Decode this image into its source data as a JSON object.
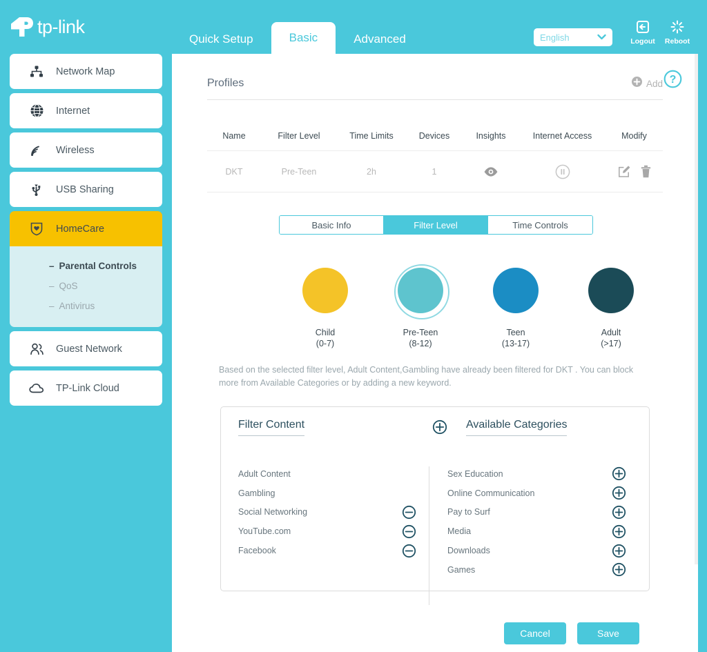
{
  "brand": {
    "name": "tp-link",
    "logo_icon": "tplink-logo-icon"
  },
  "topbar": {
    "tabs": [
      {
        "label": "Quick Setup",
        "active": false
      },
      {
        "label": "Basic",
        "active": true
      },
      {
        "label": "Advanced",
        "active": false
      }
    ],
    "language": {
      "value": "English",
      "chevron_icon": "chevron-down-icon"
    },
    "logout": {
      "label": "Logout",
      "icon": "logout-icon"
    },
    "reboot": {
      "label": "Reboot",
      "icon": "reboot-icon"
    }
  },
  "sidebar": {
    "items": [
      {
        "label": "Network Map",
        "icon": "network-map-icon",
        "active": false
      },
      {
        "label": "Internet",
        "icon": "globe-icon",
        "active": false
      },
      {
        "label": "Wireless",
        "icon": "wireless-signal-icon",
        "active": false
      },
      {
        "label": "USB Sharing",
        "icon": "usb-icon",
        "active": false
      },
      {
        "label": "HomeCare",
        "icon": "shield-heart-icon",
        "active": true
      },
      {
        "label": "Guest Network",
        "icon": "guest-users-icon",
        "active": false
      },
      {
        "label": "TP-Link Cloud",
        "icon": "cloud-icon",
        "active": false
      }
    ],
    "subitems": [
      {
        "label": "Parental Controls",
        "active": true
      },
      {
        "label": "QoS",
        "active": false
      },
      {
        "label": "Antivirus",
        "active": false
      }
    ],
    "active_color": "#f7c100",
    "subnav_bg": "#d8eff2"
  },
  "main": {
    "help_icon": "help-question-icon",
    "profiles": {
      "title": "Profiles",
      "add_label": "Add",
      "add_icon": "plus-circle-icon",
      "columns": [
        "Name",
        "Filter Level",
        "Time Limits",
        "Devices",
        "Insights",
        "Internet Access",
        "Modify"
      ],
      "rows": [
        {
          "name": "DKT",
          "filter_level": "Pre-Teen",
          "time_limits": "2h",
          "devices": "1",
          "insights_icon": "eye-icon",
          "internet_access_icon": "pause-circle-icon",
          "edit_icon": "edit-icon",
          "delete_icon": "trash-icon"
        }
      ]
    },
    "segmented_tabs": [
      {
        "label": "Basic Info",
        "active": false
      },
      {
        "label": "Filter Level",
        "active": true
      },
      {
        "label": "Time Controls",
        "active": false
      }
    ],
    "filter_levels": [
      {
        "name": "Child",
        "age": "(0-7)",
        "color": "#f4c328",
        "selected": false
      },
      {
        "name": "Pre-Teen",
        "age": "(8-12)",
        "color": "#5ec4ce",
        "selected": true
      },
      {
        "name": "Teen",
        "age": "(13-17)",
        "color": "#1b8dc4",
        "selected": false
      },
      {
        "name": "Adult",
        "age": "(>17)",
        "color": "#1b4b57",
        "selected": false
      }
    ],
    "description": "Based on the selected filter level, Adult Content,Gambling have already been filtered for DKT . You can block more from Available Categories or by adding a new keyword.",
    "filter_panel": {
      "left_title": "Filter Content",
      "right_title": "Available Categories",
      "add_keyword_icon": "plus-circle-outline-icon",
      "filter_content": [
        {
          "label": "Adult Content",
          "removable": false
        },
        {
          "label": "Gambling",
          "removable": false
        },
        {
          "label": "Social Networking",
          "removable": true,
          "action_icon": "minus-circle-outline-icon"
        },
        {
          "label": "YouTube.com",
          "removable": true,
          "action_icon": "minus-circle-outline-icon"
        },
        {
          "label": "Facebook",
          "removable": true,
          "action_icon": "minus-circle-outline-icon"
        }
      ],
      "available_categories": [
        {
          "label": "Sex Education",
          "action_icon": "plus-circle-outline-icon"
        },
        {
          "label": "Online Communication",
          "action_icon": "plus-circle-outline-icon"
        },
        {
          "label": "Pay to Surf",
          "action_icon": "plus-circle-outline-icon"
        },
        {
          "label": "Media",
          "action_icon": "plus-circle-outline-icon"
        },
        {
          "label": "Downloads",
          "action_icon": "plus-circle-outline-icon"
        },
        {
          "label": "Games",
          "action_icon": "plus-circle-outline-icon"
        }
      ]
    },
    "footer": {
      "cancel_label": "Cancel",
      "save_label": "Save"
    }
  },
  "colors": {
    "brand_teal": "#4ac8db",
    "accent_yellow": "#f7c100",
    "panel_dark_teal": "#2c4f5e"
  }
}
